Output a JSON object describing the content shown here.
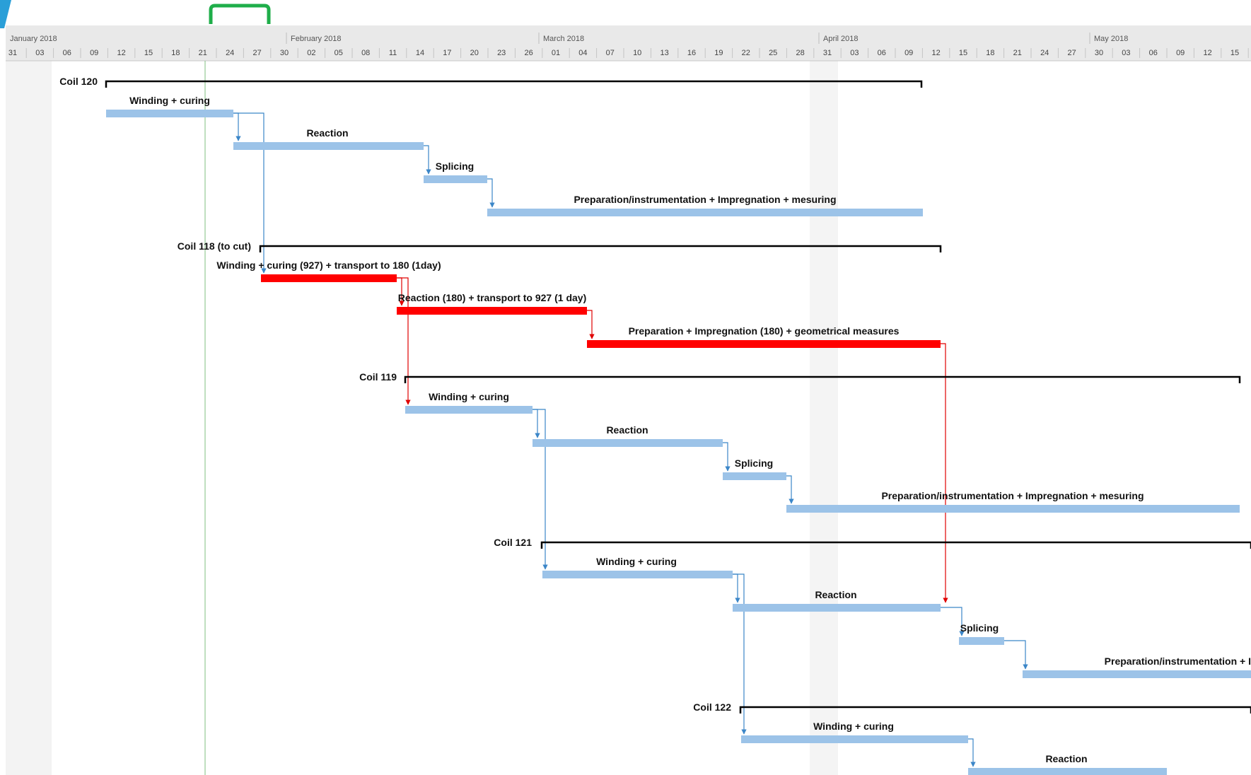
{
  "timescale": {
    "months": [
      {
        "label": "January 2018"
      },
      {
        "label": "February 2018"
      },
      {
        "label": "March 2018"
      },
      {
        "label": "April 2018"
      },
      {
        "label": "May 2018"
      }
    ],
    "days": [
      "31",
      "03",
      "06",
      "09",
      "12",
      "15",
      "18",
      "21",
      "24",
      "27",
      "30",
      "02",
      "05",
      "08",
      "11",
      "14",
      "17",
      "20",
      "23",
      "26",
      "01",
      "04",
      "07",
      "10",
      "13",
      "16",
      "19",
      "22",
      "25",
      "28",
      "31",
      "03",
      "06",
      "09",
      "12",
      "15",
      "18",
      "21",
      "24",
      "27",
      "30",
      "03",
      "06",
      "09",
      "12",
      "15"
    ]
  },
  "colors": {
    "normal_bar": "#9cc3e8",
    "critical_bar": "#ff0000",
    "summary_bar": "#000000",
    "link": "#3b86c8",
    "critical_link": "#e00000",
    "today_line": "#7fbf7f",
    "header_bg": "#e9e9e9",
    "nonworking_shade": "#f3f3f3",
    "scroll_handle": "#1fae4a",
    "corner_accent": "#2a9fd8"
  },
  "tasks": [
    {
      "name": "Coil 120",
      "type": "summary"
    },
    {
      "name": "Winding + curing",
      "type": "task"
    },
    {
      "name": "Reaction",
      "type": "task"
    },
    {
      "name": "Splicing",
      "type": "task"
    },
    {
      "name": "Preparation/instrumentation + Impregnation + mesuring",
      "type": "task"
    },
    {
      "name": "Coil 118 (to cut)",
      "type": "summary"
    },
    {
      "name": "Winding + curing (927) + transport to 180 (1day)",
      "type": "critical"
    },
    {
      "name": "Reaction (180) + transport to 927 (1 day)",
      "type": "critical"
    },
    {
      "name": "Preparation  + Impregnation (180) + geometrical measures",
      "type": "critical"
    },
    {
      "name": "Coil 119",
      "type": "summary"
    },
    {
      "name": "Winding + curing",
      "type": "task"
    },
    {
      "name": "Reaction",
      "type": "task"
    },
    {
      "name": "Splicing",
      "type": "task"
    },
    {
      "name": "Preparation/instrumentation + Impregnation + mesuring",
      "type": "task"
    },
    {
      "name": "Coil 121",
      "type": "summary"
    },
    {
      "name": "Winding + curing",
      "type": "task"
    },
    {
      "name": "Reaction",
      "type": "task"
    },
    {
      "name": "Splicing",
      "type": "task"
    },
    {
      "name": "Preparation/instrumentation + I",
      "type": "task"
    },
    {
      "name": "Coil 122",
      "type": "summary"
    },
    {
      "name": "Winding + curing",
      "type": "task"
    },
    {
      "name": "Reaction",
      "type": "task"
    }
  ]
}
